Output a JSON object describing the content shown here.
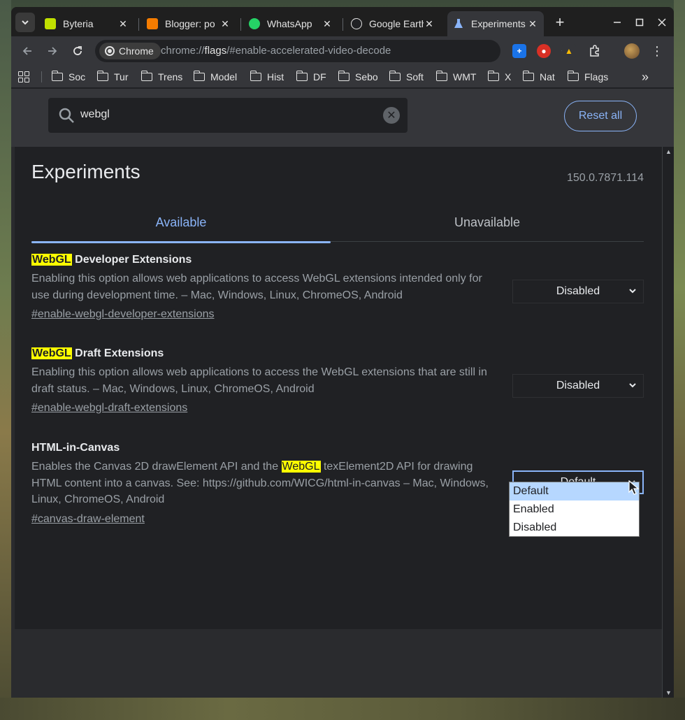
{
  "tabs": [
    {
      "label": "Byteria",
      "favicon_color": "#c0e000"
    },
    {
      "label": "Blogger: po",
      "favicon_color": "#f57c00"
    },
    {
      "label": "WhatsApp",
      "favicon_color": "#25d366"
    },
    {
      "label": "Google Earth",
      "favicon_color": "#e3e3e3"
    },
    {
      "label": "Experiments",
      "favicon_color": "#8ab4f8",
      "active": true
    }
  ],
  "toolbar": {
    "chip_label": "Chrome",
    "url_prefix": "chrome://",
    "url_host": "flags",
    "url_rest": "/#enable-accelerated-video-decode"
  },
  "bookmarks": [
    "Soc",
    "Tur",
    "Trens",
    "Model",
    "Hist",
    "DF",
    "Sebo",
    "Soft",
    "WMT",
    "X",
    "Nat",
    "Flags"
  ],
  "search": {
    "query": "webgl"
  },
  "reset_label": "Reset all",
  "page": {
    "title": "Experiments",
    "version": "150.0.7871.114",
    "tab_available": "Available",
    "tab_unavailable": "Unavailable"
  },
  "flags": [
    {
      "name_hl": "WebGL",
      "name_rest": " Developer Extensions",
      "description": "Enabling this option allows web applications to access WebGL extensions intended only for use during development time. – Mac, Windows, Linux, ChromeOS, Android",
      "link": "#enable-webgl-developer-extensions",
      "value": "Disabled"
    },
    {
      "name_hl": "WebGL",
      "name_rest": " Draft Extensions",
      "description": "Enabling this option allows web applications to access the WebGL extensions that are still in draft status. – Mac, Windows, Linux, ChromeOS, Android",
      "link": "#enable-webgl-draft-extensions",
      "value": "Disabled"
    },
    {
      "name": "HTML-in-Canvas",
      "description_pre": "Enables the Canvas 2D drawElement API and the ",
      "description_hl": "WebGL",
      "description_post": " texElement2D API for drawing HTML content into a canvas. See: https://github.com/WICG/html-in-canvas – Mac, Windows, Linux, ChromeOS, Android",
      "link": "#canvas-draw-element",
      "value": "Default",
      "options": [
        "Default",
        "Enabled",
        "Disabled"
      ]
    }
  ],
  "colors": {
    "accent": "#8ab4f8",
    "highlight": "#ffff00",
    "selected_option": "#b6d7ff"
  }
}
